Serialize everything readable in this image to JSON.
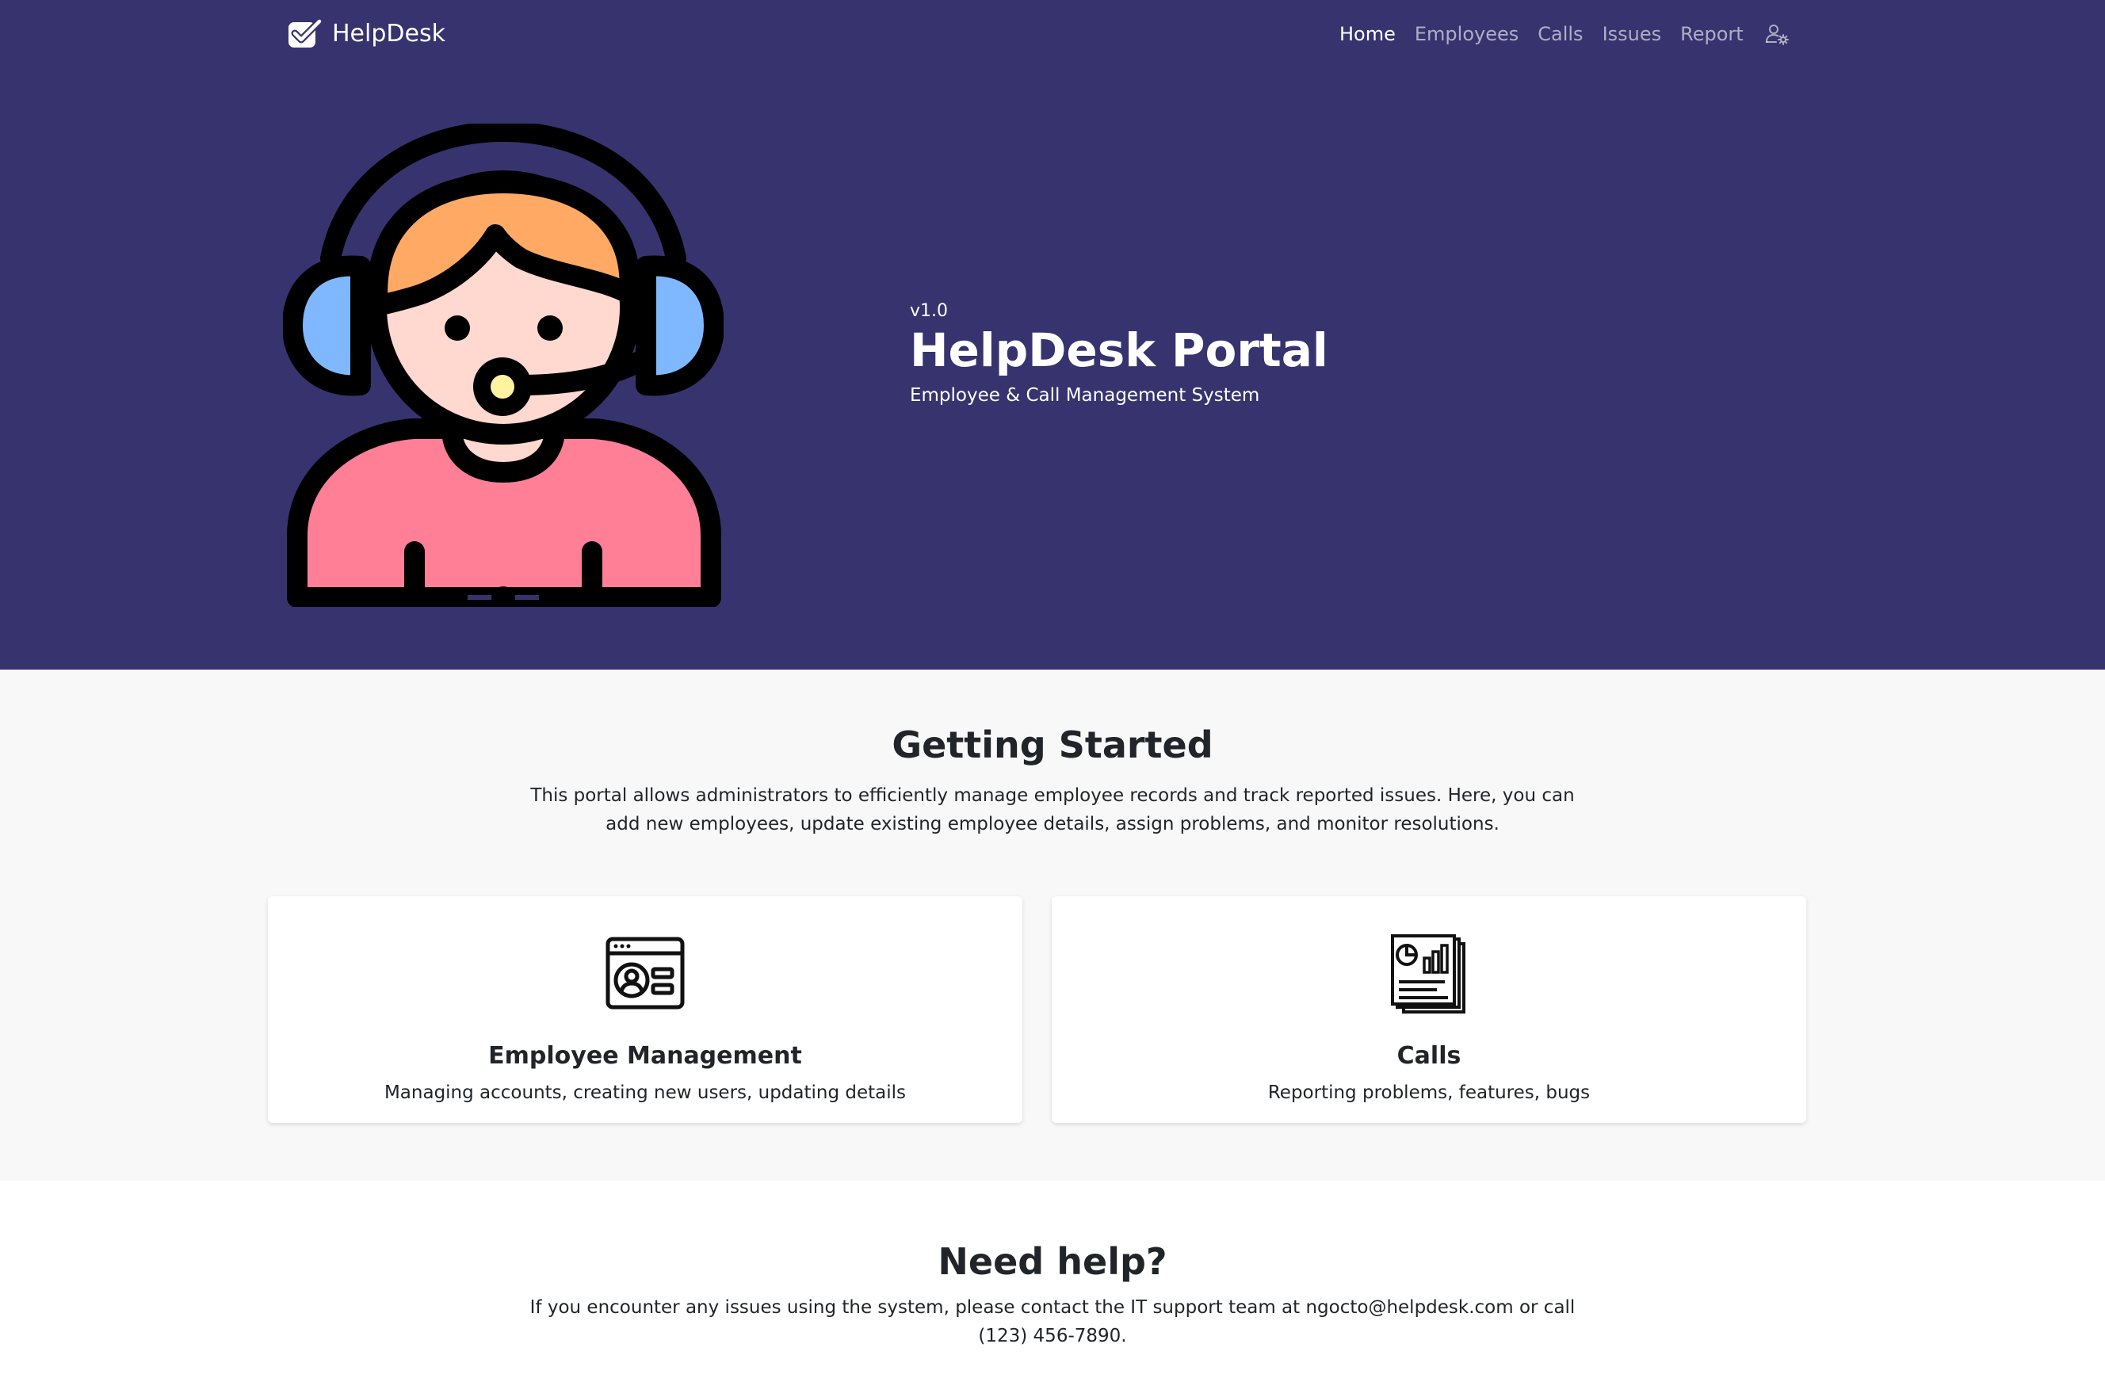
{
  "navbar": {
    "brand_label": "HelpDesk",
    "links": [
      {
        "label": "Home",
        "active": true
      },
      {
        "label": "Employees",
        "active": false
      },
      {
        "label": "Calls",
        "active": false
      },
      {
        "label": "Issues",
        "active": false
      },
      {
        "label": "Report",
        "active": false
      }
    ],
    "brand_icon": "check-square-icon",
    "user_icon": "user-settings-icon"
  },
  "hero": {
    "version": "v1.0",
    "title": "HelpDesk Portal",
    "subtitle": "Employee & Call Management System",
    "illustration": "support-agent-headset-illustration"
  },
  "getting_started": {
    "title": "Getting Started",
    "description": "This portal allows administrators to efficiently manage employee records and track reported issues. Here, you can add new employees, update existing employee details, assign problems, and monitor resolutions.",
    "cards": [
      {
        "icon": "employee-id-card-icon",
        "title": "Employee Management",
        "text": "Managing accounts, creating new users, updating details"
      },
      {
        "icon": "report-chart-document-icon",
        "title": "Calls",
        "text": "Reporting problems, features, bugs"
      }
    ]
  },
  "help": {
    "title": "Need help?",
    "description": "If you encounter any issues using the system, please contact the IT support team at ngocto@helpdesk.com or call (123) 456-7890."
  },
  "colors": {
    "hero_background": "#36336f",
    "section_background": "#f8f8f8",
    "text": "#212529",
    "nav_inactive": "rgba(255,255,255,0.6)"
  }
}
